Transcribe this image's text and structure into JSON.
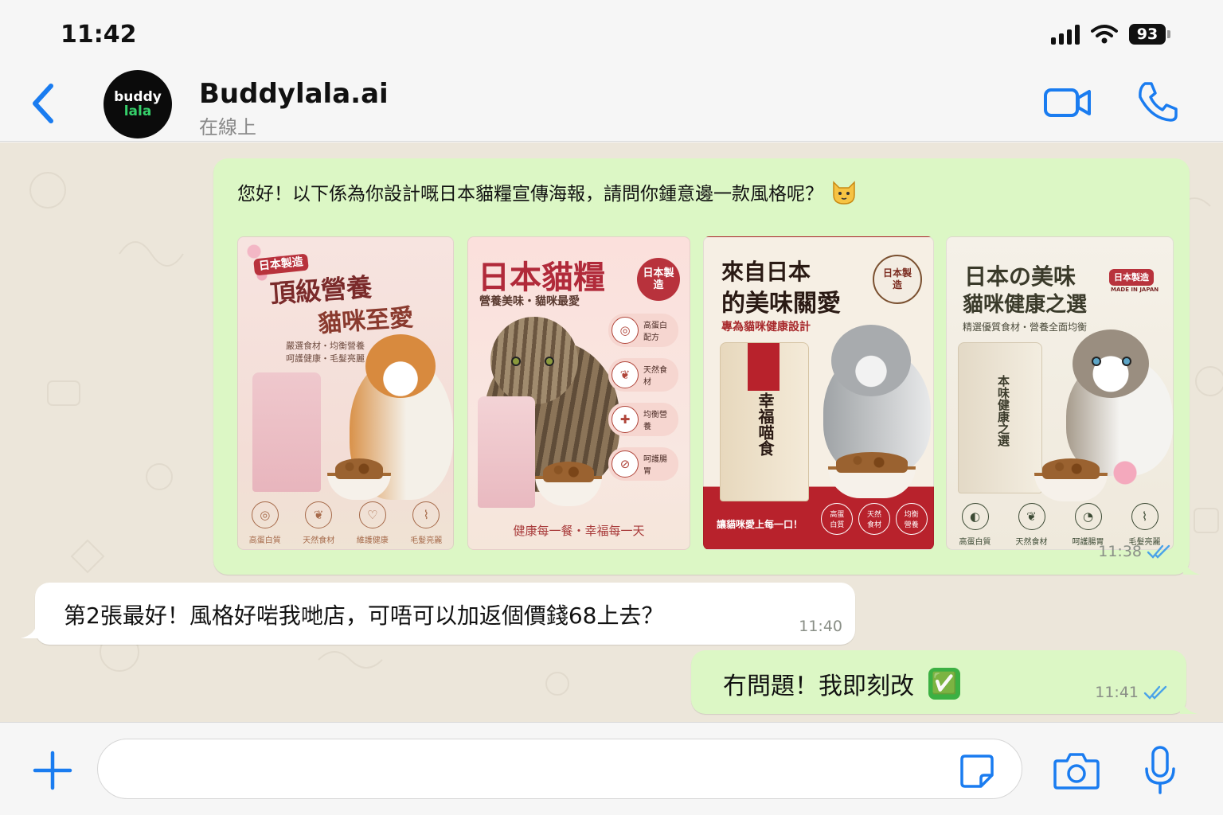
{
  "status_bar": {
    "time": "11:42",
    "battery": "93"
  },
  "header": {
    "contact_name": "Buddylala.ai",
    "contact_status": "在線上",
    "avatar_line1": "buddy",
    "avatar_line2": "lala"
  },
  "messages": [
    {
      "id": "m1",
      "direction": "incoming-bot",
      "text": "您好！以下係為你設計嘅日本貓糧宣傳海報，請問你鍾意邊一款風格呢？",
      "time": "11:38",
      "posters": [
        {
          "badge": "日本製造",
          "title_line1": "頂級營養",
          "title_line2": "貓咪至愛",
          "sub1": "嚴選食材・均衡營養",
          "sub2": "呵護健康・毛髮亮麗",
          "icons": [
            "高蛋白質",
            "天然食材",
            "維護健康",
            "毛髮亮麗"
          ]
        },
        {
          "title": "日本貓糧",
          "badge": "日本製造",
          "sub": "營養美味・貓咪最愛",
          "features": [
            "高蛋白配方",
            "天然食材",
            "均衡營養",
            "呵護腸胃"
          ],
          "footer": "健康每一餐・幸福每一天"
        },
        {
          "title_line1": "來自日本",
          "title_line2": "的美味關愛",
          "badge": "日本製造",
          "sub": "專為貓咪健康設計",
          "bag_text": "幸福喵食",
          "footer": "讓貓咪愛上每一口！",
          "icons": [
            "高蛋白質",
            "天然食材",
            "均衡營養"
          ]
        },
        {
          "title_line1": "日本の美味",
          "title_line2": "貓咪健康之選",
          "badge": "日本製造",
          "badge_sub": "MADE IN JAPAN",
          "sub": "精選優質食材・營養全面均衡",
          "bag_text": "本味健康之選",
          "icons": [
            "高蛋白質",
            "天然食材",
            "呵護腸胃",
            "毛髮亮麗"
          ]
        }
      ]
    },
    {
      "id": "m2",
      "direction": "incoming",
      "text": "第2張最好！風格好啱我哋店，可唔可以加返個價錢68上去？",
      "time": "11:40"
    },
    {
      "id": "m3",
      "direction": "outgoing",
      "text": "冇問題！我即刻改",
      "emoji": "✅",
      "time": "11:41"
    }
  ],
  "input": {
    "placeholder": ""
  },
  "colors": {
    "accent": "#1a7cf0",
    "outgoing_bubble": "#dcf7c5",
    "incoming_bubble": "#ffffff",
    "chat_bg": "#ece6da",
    "tick": "#4aa3e8"
  }
}
